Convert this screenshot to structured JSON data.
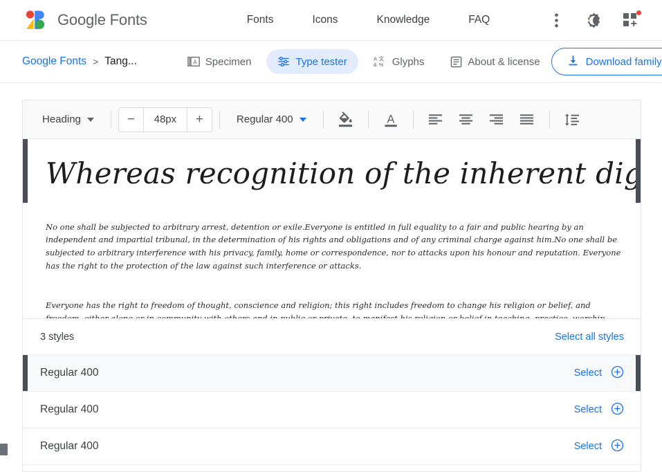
{
  "header": {
    "logo_name": "google-fonts-logo",
    "brand_google": "Google",
    "brand_fonts": "Fonts",
    "nav": [
      {
        "label": "Fonts",
        "name": "nav-fonts"
      },
      {
        "label": "Icons",
        "name": "nav-icons"
      },
      {
        "label": "Knowledge",
        "name": "nav-knowledge"
      },
      {
        "label": "FAQ",
        "name": "nav-faq"
      }
    ],
    "actions": {
      "more_icon": "more-vert-icon",
      "theme_icon": "dark-mode-icon",
      "apps_icon": "apps-add-icon",
      "apps_badge": true
    }
  },
  "subheader": {
    "breadcrumb_root": "Google Fonts",
    "breadcrumb_separator": ">",
    "breadcrumb_current": "Tang...",
    "tabs": [
      {
        "label": "Specimen",
        "icon": "specimen-icon",
        "active": false
      },
      {
        "label": "Type tester",
        "icon": "tuner-icon",
        "active": true
      },
      {
        "label": "Glyphs",
        "icon": "glyphs-icon",
        "active": false
      },
      {
        "label": "About & license",
        "icon": "article-icon",
        "active": false
      }
    ],
    "download_label": "Download family",
    "download_icon": "download-icon"
  },
  "toolbar": {
    "block_type": "Heading",
    "size_decrease": "−",
    "size_value": "48px",
    "size_increase": "+",
    "weight": "Regular 400",
    "background_color_icon": "fill-color-icon",
    "text_color_icon": "text-color-icon",
    "align_left_icon": "align-left-icon",
    "align_center_icon": "align-center-icon",
    "align_right_icon": "align-right-icon",
    "align_justify_icon": "align-justify-icon",
    "line_height_icon": "line-height-icon"
  },
  "preview": {
    "heading": "Whereas recognition of the inherent dignity",
    "paragraph_1": "No one shall be subjected to arbitrary arrest, detention or exile.Everyone is entitled in full equality to a fair and public hearing by an independent and impartial tribunal, in the determination of his rights and obligations and of any criminal charge against him.No one shall be subjected to arbitrary interference with his privacy, family, home or correspondence, nor to attacks upon his honour and reputation. Everyone has the right to the protection of the law against such interference or attacks.",
    "paragraph_2": "Everyone has the right to freedom of thought, conscience and religion; this right includes freedom to change his religion or belief, and freedom, either alone or in community with others and in public or private, to manifest his religion or belief in teaching, practice, worship and observance.Everyone has the right to freedom of opinion and expression; this right includes freedom to hold opinions without interference and to seek, receive and impart information and ideas through any media and regardless of frontiers.Everyone has the right to rest and leisure, including reasonable limitation of working hours and periodic holidays with pay."
  },
  "styles": {
    "count_label": "3 styles",
    "select_all_label": "Select all styles",
    "rows": [
      {
        "name": "Regular 400",
        "action": "Select",
        "selected": true
      },
      {
        "name": "Regular 400",
        "action": "Select",
        "selected": false
      },
      {
        "name": "Regular 400",
        "action": "Select",
        "selected": false
      }
    ]
  },
  "colors": {
    "accent_blue": "#1a73e8",
    "tab_active_bg": "#e2ecfd",
    "text_primary": "#3c4043",
    "text_secondary": "#5f6368",
    "selection_bar": "#4a4f55",
    "badge_red": "#e8453c"
  }
}
